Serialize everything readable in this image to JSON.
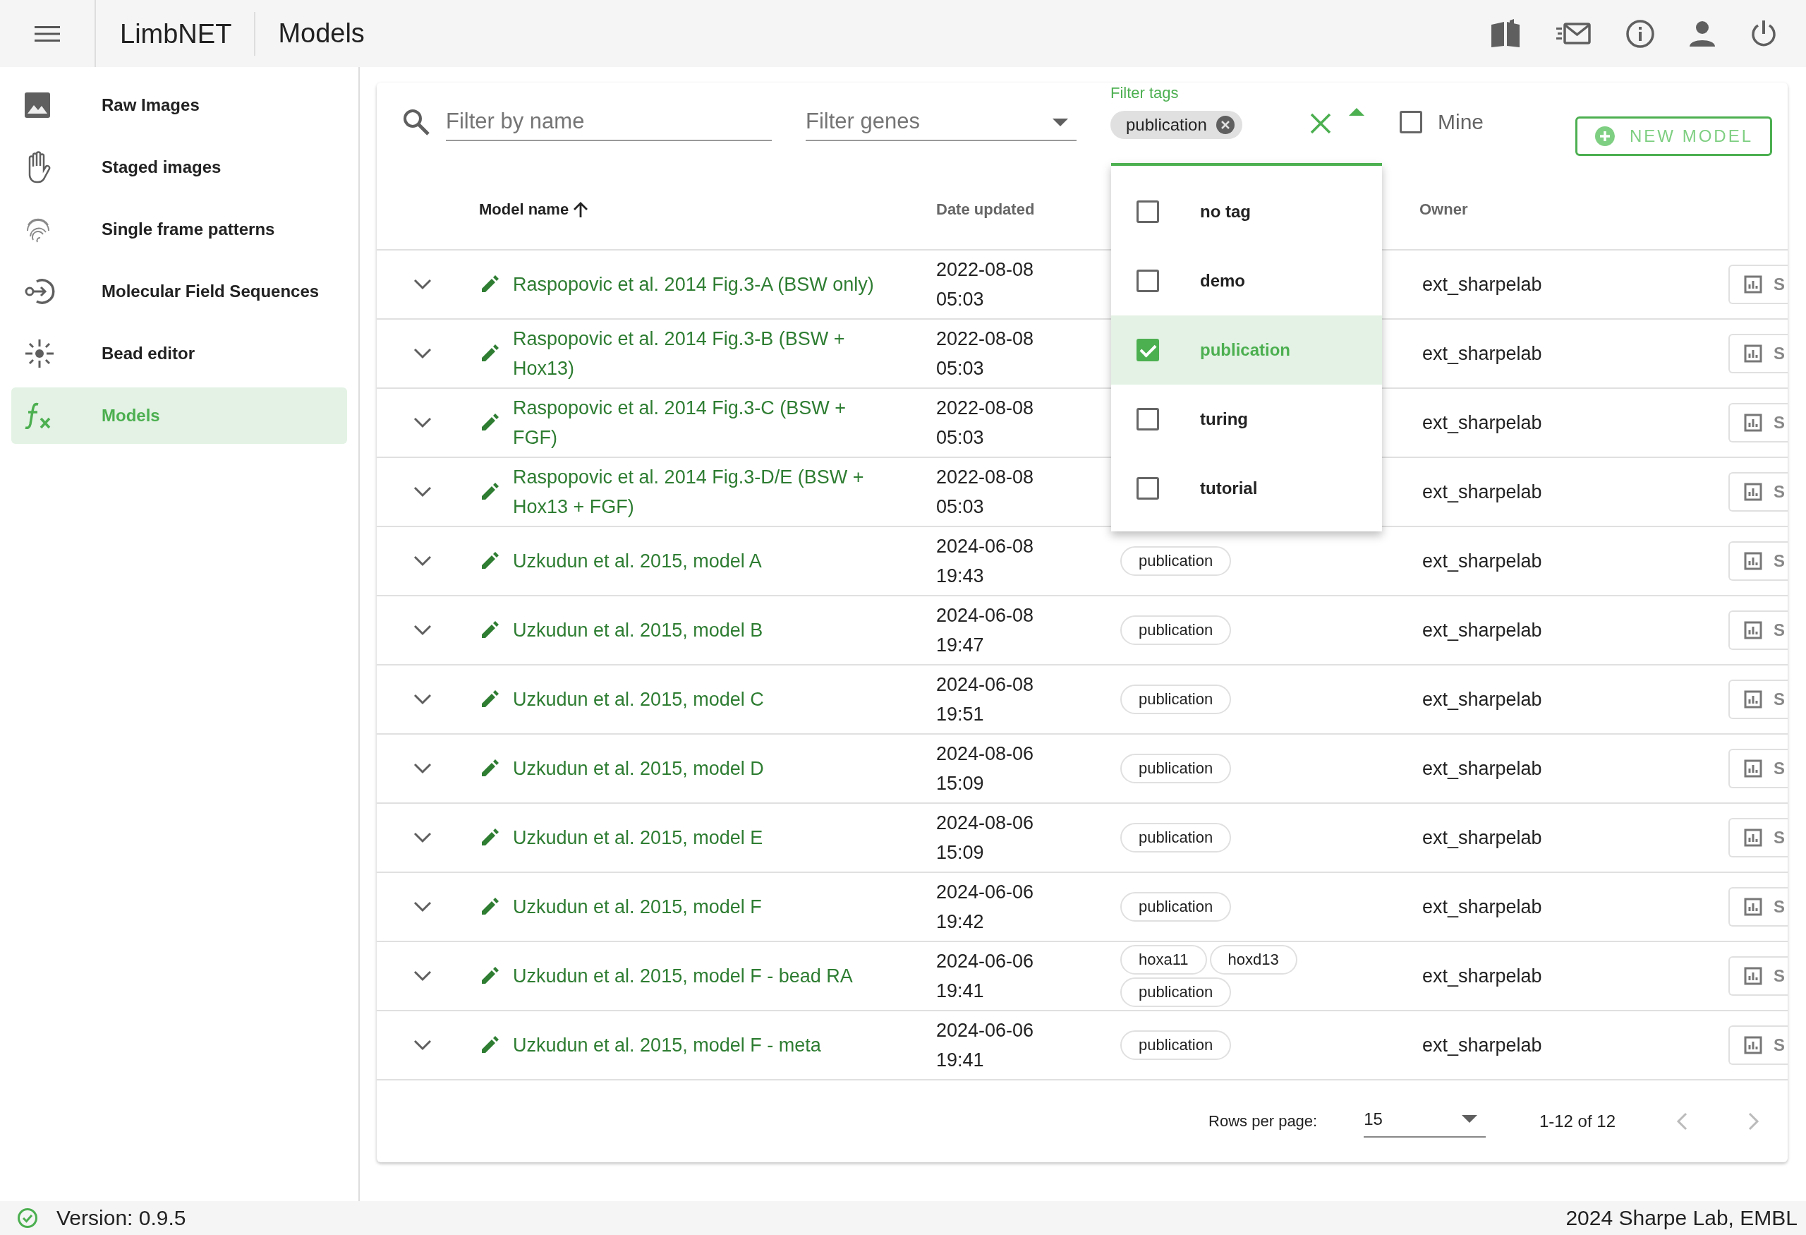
{
  "app": {
    "title": "LimbNET",
    "page": "Models"
  },
  "sidebar": {
    "items": [
      {
        "label": "Raw Images",
        "selected": false
      },
      {
        "label": "Staged images",
        "selected": false
      },
      {
        "label": "Single frame patterns",
        "selected": false
      },
      {
        "label": "Molecular Field Sequences",
        "selected": false
      },
      {
        "label": "Bead editor",
        "selected": false
      },
      {
        "label": "Models",
        "selected": true
      }
    ]
  },
  "filters": {
    "name": {
      "placeholder": "Filter by name"
    },
    "genes": {
      "placeholder": "Filter genes"
    },
    "tags": {
      "label": "Filter tags",
      "chips": [
        "publication"
      ],
      "expanded": true
    },
    "mine": {
      "label": "Mine",
      "checked": false
    },
    "new_button": "NEW MODEL"
  },
  "tag_menu": [
    {
      "label": "no tag",
      "checked": false,
      "selected": false
    },
    {
      "label": "demo",
      "checked": false,
      "selected": false
    },
    {
      "label": "publication",
      "checked": true,
      "selected": true
    },
    {
      "label": "turing",
      "checked": false,
      "selected": false
    },
    {
      "label": "tutorial",
      "checked": false,
      "selected": false
    }
  ],
  "table": {
    "columns": [
      {
        "label": "Model name",
        "sorted": true
      },
      {
        "label": "Date updated",
        "sorted": false
      },
      {
        "label": "Owner",
        "sorted": false
      }
    ],
    "rows": [
      {
        "name": "Raspopovic et al. 2014 Fig.3-A (BSW only)",
        "date": "2022-08-08 05:03",
        "owner": "ext_sharpelab",
        "action": "S"
      },
      {
        "name": "Raspopovic et al. 2014 Fig.3-B (BSW + Hox13)",
        "date": "2022-08-08 05:03",
        "owner": "ext_sharpelab",
        "action": "S"
      },
      {
        "name": "Raspopovic et al. 2014 Fig.3-C (BSW + FGF)",
        "date": "2022-08-08 05:03",
        "owner": "ext_sharpelab",
        "action": "S"
      },
      {
        "name": "Raspopovic et al. 2014 Fig.3-D/E (BSW + Hox13 + FGF)",
        "date": "2022-08-08 05:03",
        "owner": "ext_sharpelab",
        "action": "S"
      },
      {
        "name": "Uzkudun et al. 2015, model A",
        "date": "2024-06-08 19:43",
        "tags": [
          "publication"
        ],
        "owner": "ext_sharpelab",
        "action": "S"
      },
      {
        "name": "Uzkudun et al. 2015, model B",
        "date": "2024-06-08 19:47",
        "tags": [
          "publication"
        ],
        "owner": "ext_sharpelab",
        "action": "S"
      },
      {
        "name": "Uzkudun et al. 2015, model C",
        "date": "2024-06-08 19:51",
        "tags": [
          "publication"
        ],
        "owner": "ext_sharpelab",
        "action": "S"
      },
      {
        "name": "Uzkudun et al. 2015, model D",
        "date": "2024-08-06 15:09",
        "tags": [
          "publication"
        ],
        "owner": "ext_sharpelab",
        "action": "S"
      },
      {
        "name": "Uzkudun et al. 2015, model E",
        "date": "2024-08-06 15:09",
        "tags": [
          "publication"
        ],
        "owner": "ext_sharpelab",
        "action": "S"
      },
      {
        "name": "Uzkudun et al. 2015, model F",
        "date": "2024-06-06 19:42",
        "tags": [
          "publication"
        ],
        "owner": "ext_sharpelab",
        "action": "S"
      },
      {
        "name": "Uzkudun et al. 2015, model F - bead RA",
        "date": "2024-06-06 19:41",
        "tags": [
          "hoxa11",
          "hoxd13",
          "publication"
        ],
        "owner": "ext_sharpelab",
        "action": "S"
      },
      {
        "name": "Uzkudun et al. 2015, model F - meta",
        "date": "2024-06-06 19:41",
        "tags": [
          "publication"
        ],
        "owner": "ext_sharpelab",
        "action": "S"
      }
    ]
  },
  "pagination": {
    "label": "Rows per page:",
    "rows_per_page": "15",
    "range": "1-12 of 12"
  },
  "status_bar": {
    "ok": true,
    "version": "Version: 0.9.5",
    "copyright": "2024 Sharpe Lab, EMBL"
  }
}
